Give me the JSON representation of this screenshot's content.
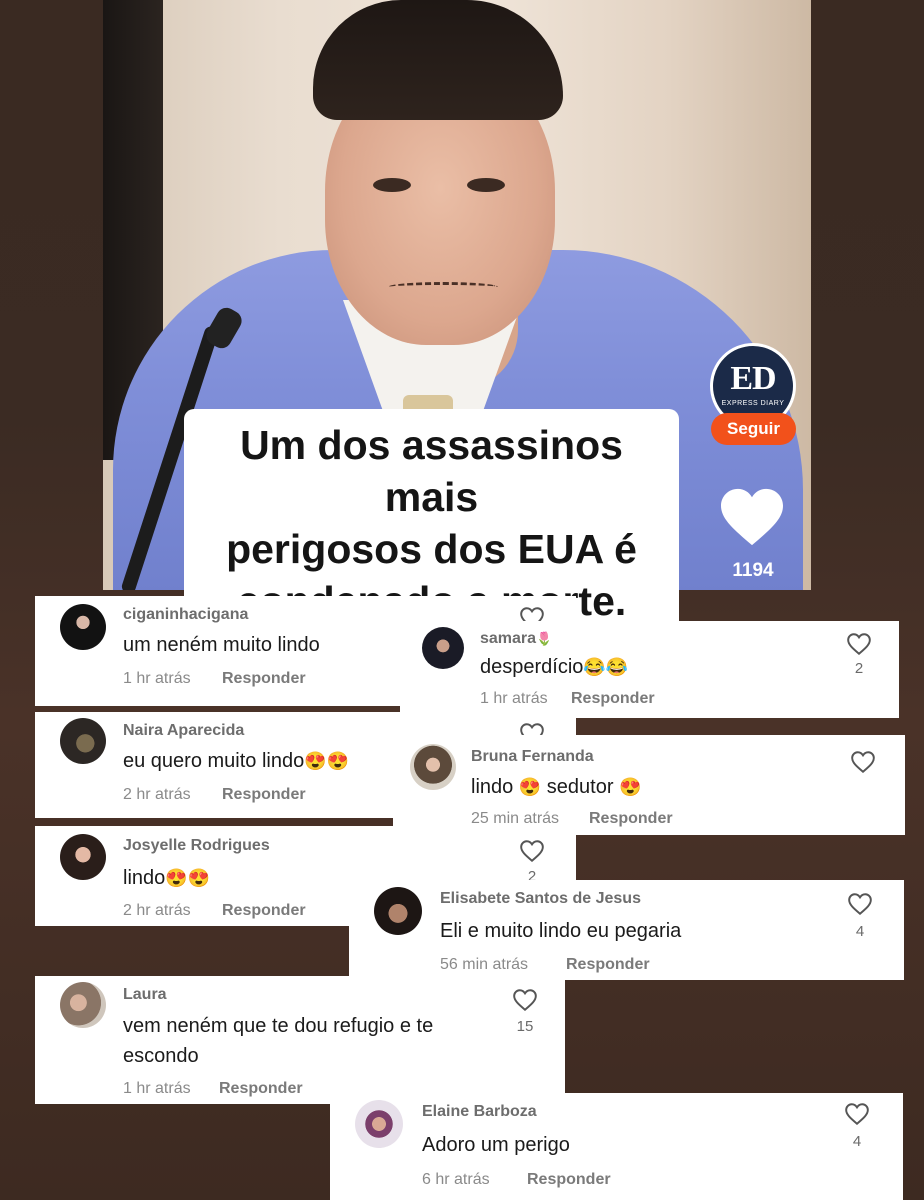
{
  "video": {
    "caption": [
      "Um dos assassinos mais",
      "perigosos dos EUA é",
      "condenado a morte."
    ],
    "brand_logo": {
      "initials": "ED",
      "subtitle": "EXPRESS DIARY"
    },
    "follow_label": "Seguir",
    "like_count": "1194"
  },
  "reply_label": "Responder",
  "comments": [
    {
      "user": "ciganinhacigana",
      "text": "um neném muito lindo",
      "time": "1 hr atrás",
      "likes": ""
    },
    {
      "user": "samara",
      "user_emoji": "🌷",
      "text": "desperdício",
      "text_emoji": "😂😂",
      "time": "1 hr atrás",
      "likes": "2"
    },
    {
      "user": "Naira Aparecida",
      "text": "eu quero muito lindo",
      "text_emoji": "😍😍",
      "time": "2 hr atrás",
      "likes": ""
    },
    {
      "user": "Bruna Fernanda",
      "text_parts": [
        "lindo ",
        "😍",
        " sedutor ",
        "😍"
      ],
      "time": "25 min atrás",
      "likes": ""
    },
    {
      "user": "Josyelle Rodrigues",
      "text": "lindo",
      "text_emoji": "😍😍",
      "time": "2 hr atrás",
      "likes": "2"
    },
    {
      "user": "Elisabete Santos de Jesus",
      "text": "Eli e muito lindo eu pegaria",
      "time": "56 min atrás",
      "likes": "4"
    },
    {
      "user": "Laura",
      "text_lines": [
        "vem neném que te dou refugio e te",
        "escondo"
      ],
      "time": "1 hr atrás",
      "likes": "15"
    },
    {
      "user": "Elaine Barboza",
      "text": "Adoro um perigo",
      "time": "6 hr atrás",
      "likes": "4"
    }
  ],
  "colors": {
    "background": "#3b2b23",
    "follow_button": "#f2511b",
    "brand_logo_bg": "#1b2a48",
    "username": "#6d6d6d",
    "meta": "#8a8a8a"
  },
  "icons": {
    "like": "heart-outline-icon",
    "video_like": "heart-filled-icon"
  }
}
